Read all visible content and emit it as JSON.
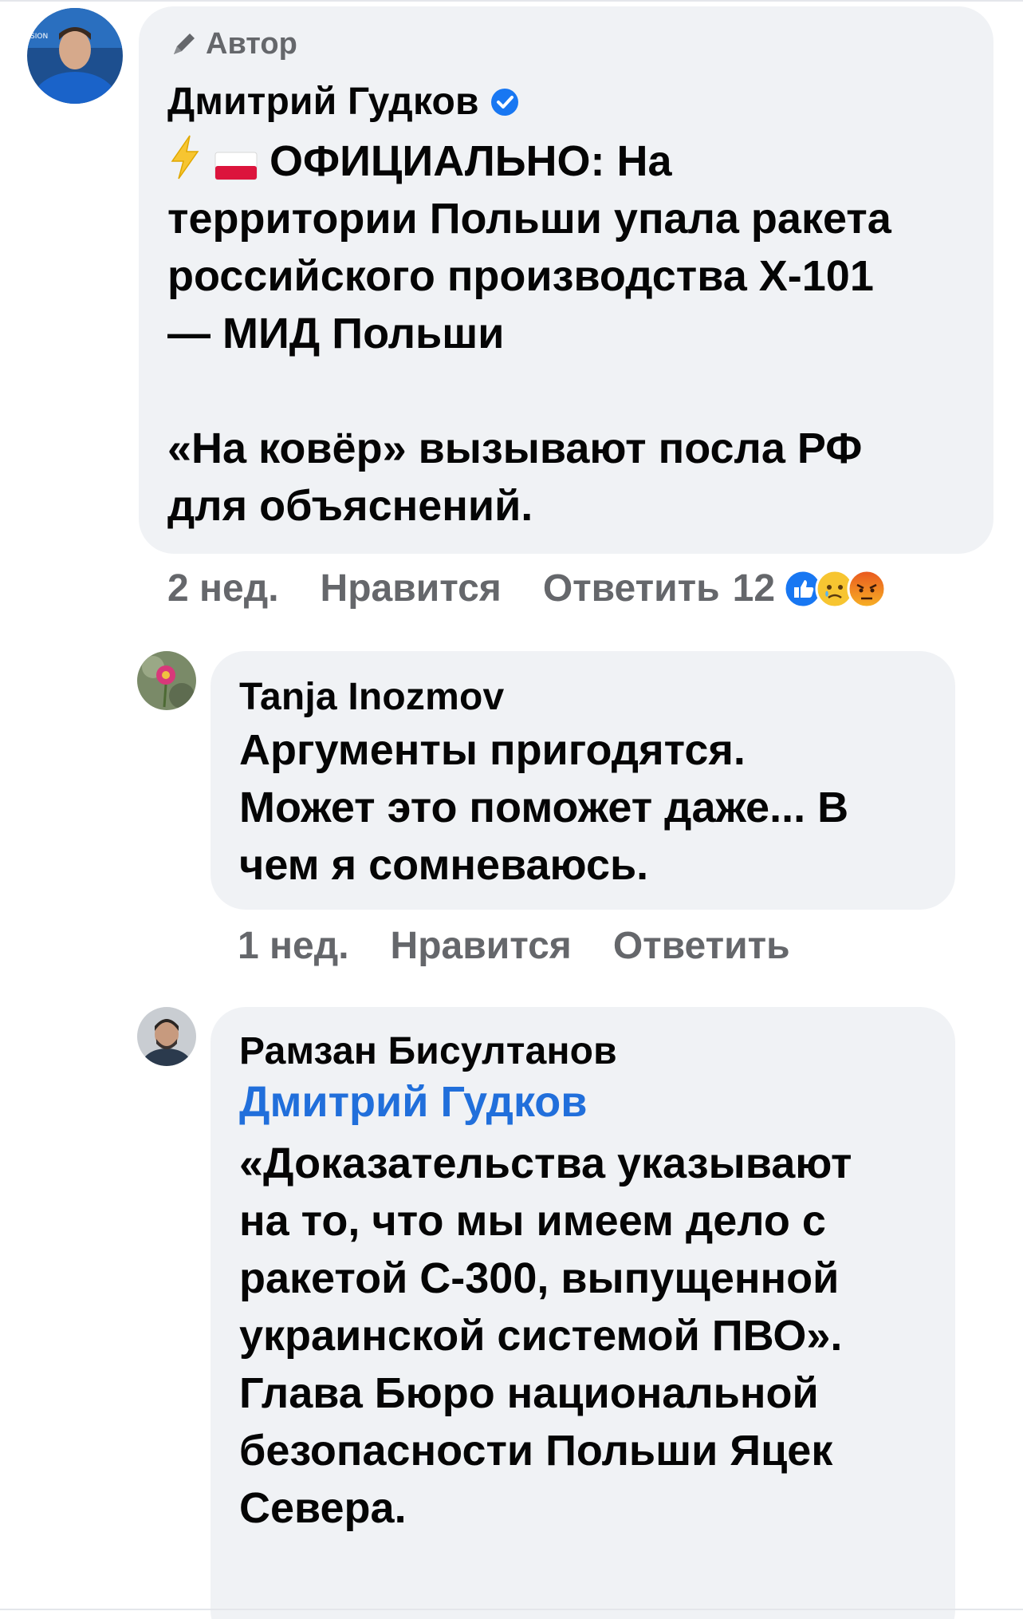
{
  "post": {
    "author_badge": "Автор",
    "author_name": "Дмитрий Гудков",
    "line1_suffix": "ОФИЦИАЛЬНО: На",
    "body_rest": "территории Польши упала ракета\nроссийского производства Х-101\n— МИД Польши\n\n«На ковёр» вызывают посла РФ\nдля объяснений.",
    "time": "2 нед.",
    "like_label": "Нравится",
    "reply_label": "Ответить",
    "reaction_count": "12",
    "reaction_icons": [
      "like-icon",
      "sad-icon",
      "angry-icon"
    ],
    "lightning_icon": "lightning-icon",
    "flag_icon": "poland-flag-icon"
  },
  "replies": [
    {
      "name": "Tanja Inozmov",
      "text": "Аргументы пригодятся.\nМожет это поможет даже... В\nчем я сомневаюсь.",
      "time": "1 нед.",
      "like_label": "Нравится",
      "reply_label": "Ответить"
    },
    {
      "name": "Рамзан Бисултанов",
      "mention": "Дмитрий Гудков",
      "text": "«Доказательства указывают\nна то, что мы имеем дело с\nракетой С-300, выпущенной\nукраинской системой ПВО».\nГлава Бюро национальной\nбезопасности Польши Яцек\nСевера."
    }
  ],
  "colors": {
    "bubble": "#f0f2f5",
    "secondary_text": "#65676b",
    "mention": "#216fdb",
    "verified": "#1877f2"
  }
}
